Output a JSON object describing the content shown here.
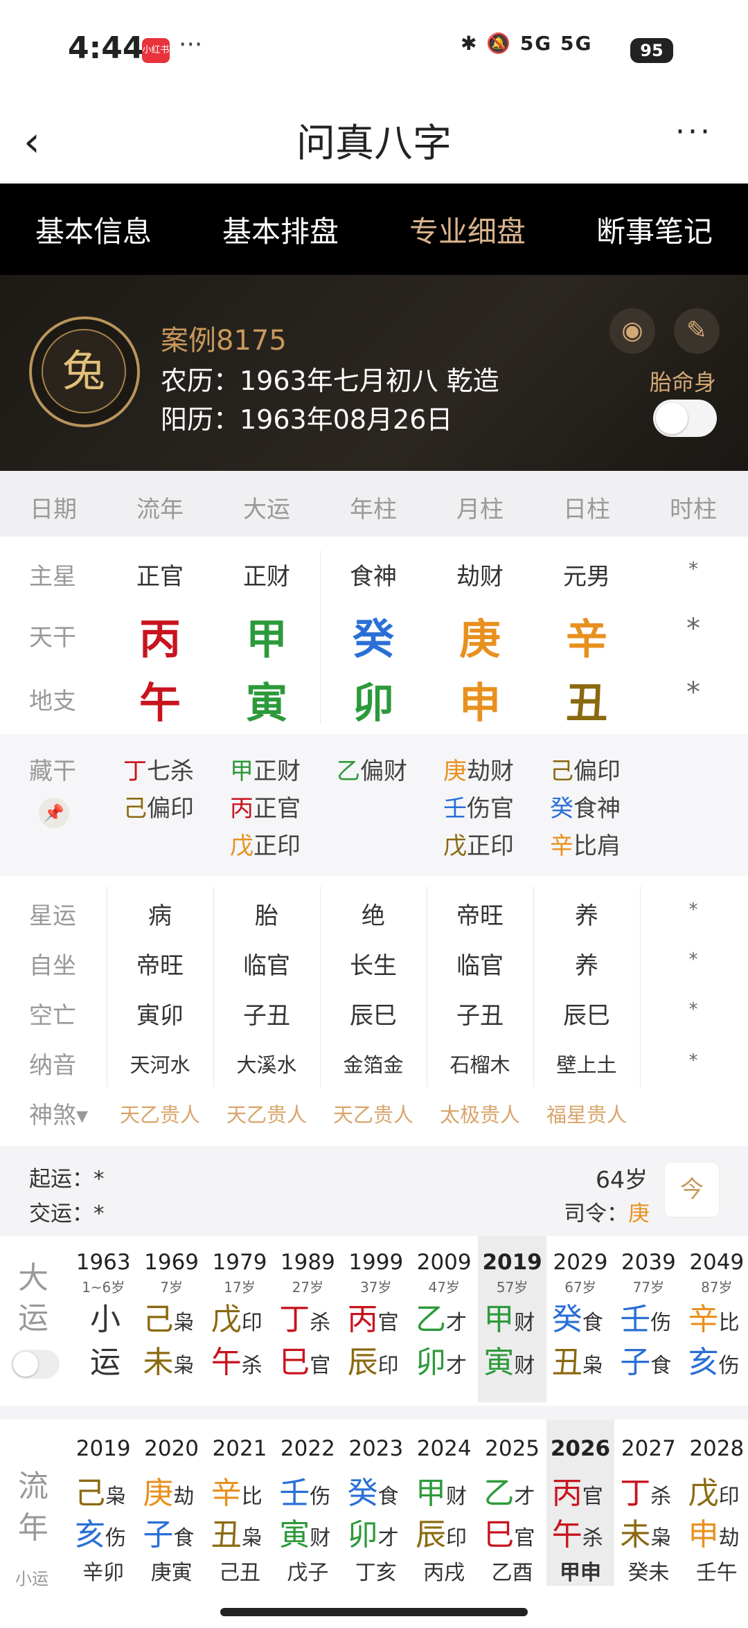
{
  "status": {
    "time": "4:44",
    "app_badge": "小红书",
    "dots": "···",
    "signal": "5G 5G",
    "battery": "95"
  },
  "header": {
    "title": "问真八字",
    "back": "‹",
    "more": "···"
  },
  "tabs": [
    {
      "label": "基本信息"
    },
    {
      "label": "基本排盘"
    },
    {
      "label": "专业细盘"
    },
    {
      "label": "断事笔记"
    }
  ],
  "profile": {
    "case": "案例8175",
    "lunar": "农历：1963年七月初八 乾造",
    "solar": "阳历：1963年08月26日",
    "tai": "胎命身",
    "avatar_char": "兔"
  },
  "col_headers": [
    "日期",
    "流年",
    "大运",
    "年柱",
    "月柱",
    "日柱",
    "时柱"
  ],
  "row_labels": {
    "zhuxing": "主星",
    "tiangan": "天干",
    "dizhi": "地支",
    "canggan": "藏干",
    "xingyun": "星运",
    "zizuo": "自坐",
    "kongwang": "空亡",
    "nayin": "纳音",
    "shensha": "神煞▾"
  },
  "zhuxing": [
    "正官",
    "正财",
    "食神",
    "劫财",
    "元男",
    "*"
  ],
  "tiangan": [
    "丙",
    "甲",
    "癸",
    "庚",
    "辛",
    "*"
  ],
  "dizhi": [
    "午",
    "寅",
    "卯",
    "申",
    "丑",
    "*"
  ],
  "colors": {
    "fire": "#c8141e",
    "wood": "#2c9a3a",
    "water": "#2a6fd6",
    "metal": "#e8901e",
    "earth": "#8a6a10",
    "gold": "#d9b38c"
  },
  "canggan": [
    [
      {
        "g": "丁",
        "s": "七杀"
      },
      {
        "g": "己",
        "s": "偏印"
      }
    ],
    [
      {
        "g": "甲",
        "s": "正财"
      },
      {
        "g": "丙",
        "s": "正官"
      },
      {
        "g": "戊",
        "s": "正印"
      }
    ],
    [
      {
        "g": "乙",
        "s": "偏财"
      }
    ],
    [
      {
        "g": "庚",
        "s": "劫财"
      },
      {
        "g": "壬",
        "s": "伤官"
      },
      {
        "g": "戊",
        "s": "正印"
      }
    ],
    [
      {
        "g": "己",
        "s": "偏印"
      },
      {
        "g": "癸",
        "s": "食神"
      },
      {
        "g": "辛",
        "s": "比肩"
      }
    ]
  ],
  "xingyun": [
    "病",
    "胎",
    "绝",
    "帝旺",
    "养",
    "*"
  ],
  "zizuo": [
    "帝旺",
    "临官",
    "长生",
    "临官",
    "养",
    "*"
  ],
  "kongwang": [
    "寅卯",
    "子丑",
    "辰巳",
    "子丑",
    "辰巳",
    "*"
  ],
  "nayin": [
    "天河水",
    "大溪水",
    "金箔金",
    "石榴木",
    "壁上土",
    "*"
  ],
  "shensha": [
    "天乙贵人",
    "天乙贵人",
    "天乙贵人",
    "太极贵人",
    "福星贵人"
  ],
  "qiyun": {
    "qi": "起运：*",
    "jiao": "交运：*",
    "age": "64岁",
    "siling_label": "司令：",
    "siling": "庚",
    "jin": "今"
  },
  "dayun": {
    "label1": "大",
    "label2": "运",
    "items": [
      {
        "year": "1963",
        "age": "1~6岁",
        "g": "小",
        "gs": "",
        "z": "运",
        "zs": ""
      },
      {
        "year": "1969",
        "age": "7岁",
        "g": "己",
        "gs": "枭",
        "z": "未",
        "zs": "枭"
      },
      {
        "year": "1979",
        "age": "17岁",
        "g": "戊",
        "gs": "印",
        "z": "午",
        "zs": "杀"
      },
      {
        "year": "1989",
        "age": "27岁",
        "g": "丁",
        "gs": "杀",
        "z": "巳",
        "zs": "官"
      },
      {
        "year": "1999",
        "age": "37岁",
        "g": "丙",
        "gs": "官",
        "z": "辰",
        "zs": "印"
      },
      {
        "year": "2009",
        "age": "47岁",
        "g": "乙",
        "gs": "才",
        "z": "卯",
        "zs": "才"
      },
      {
        "year": "2019",
        "age": "57岁",
        "g": "甲",
        "gs": "财",
        "z": "寅",
        "zs": "财"
      },
      {
        "year": "2029",
        "age": "67岁",
        "g": "癸",
        "gs": "食",
        "z": "丑",
        "zs": "枭"
      },
      {
        "year": "2039",
        "age": "77岁",
        "g": "壬",
        "gs": "伤",
        "z": "子",
        "zs": "食"
      },
      {
        "year": "2049",
        "age": "87岁",
        "g": "辛",
        "gs": "比",
        "z": "亥",
        "zs": "伤"
      }
    ]
  },
  "liunian": {
    "label1": "流",
    "label2": "年",
    "label3": "小运",
    "items": [
      {
        "year": "2019",
        "g": "己",
        "gs": "枭",
        "z": "亥",
        "zs": "伤",
        "xy": "辛卯"
      },
      {
        "year": "2020",
        "g": "庚",
        "gs": "劫",
        "z": "子",
        "zs": "食",
        "xy": "庚寅"
      },
      {
        "year": "2021",
        "g": "辛",
        "gs": "比",
        "z": "丑",
        "zs": "枭",
        "xy": "己丑"
      },
      {
        "year": "2022",
        "g": "壬",
        "gs": "伤",
        "z": "寅",
        "zs": "财",
        "xy": "戊子"
      },
      {
        "year": "2023",
        "g": "癸",
        "gs": "食",
        "z": "卯",
        "zs": "才",
        "xy": "丁亥"
      },
      {
        "year": "2024",
        "g": "甲",
        "gs": "财",
        "z": "辰",
        "zs": "印",
        "xy": "丙戌"
      },
      {
        "year": "2025",
        "g": "乙",
        "gs": "才",
        "z": "巳",
        "zs": "官",
        "xy": "乙酉"
      },
      {
        "year": "2026",
        "g": "丙",
        "gs": "官",
        "z": "午",
        "zs": "杀",
        "xy": "甲申"
      },
      {
        "year": "2027",
        "g": "丁",
        "gs": "杀",
        "z": "未",
        "zs": "枭",
        "xy": "癸未"
      },
      {
        "year": "2028",
        "g": "戊",
        "gs": "印",
        "z": "申",
        "zs": "劫",
        "xy": "壬午"
      }
    ]
  }
}
